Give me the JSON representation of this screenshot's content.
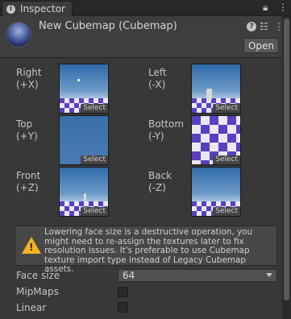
{
  "tab": {
    "title": "Inspector",
    "icon": "info-icon"
  },
  "window_controls": {
    "lock_icon": "lock-icon",
    "menu_icon": "kebab-menu-icon"
  },
  "header": {
    "title": "New Cubemap (Cubemap)",
    "help_icon": "help-icon",
    "settings_icon": "settings-sliders-icon",
    "more_icon": "kebab-menu-icon",
    "open_label": "Open"
  },
  "faces": {
    "right": {
      "name": "Right",
      "axis": "(+X)"
    },
    "left": {
      "name": "Left",
      "axis": "(-X)"
    },
    "top": {
      "name": "Top",
      "axis": "(+Y)"
    },
    "bottom": {
      "name": "Bottom",
      "axis": "(-Y)"
    },
    "front": {
      "name": "Front",
      "axis": "(+Z)"
    },
    "back": {
      "name": "Back",
      "axis": "(-Z)"
    },
    "select_label": "Select"
  },
  "help": {
    "icon": "warning-icon",
    "text": "Lowering face size is a destructive operation, you might need to re-assign the textures later to fix resolution issues. It's preferable to use Cubemap texture import type instead of Legacy Cubemap assets."
  },
  "properties": {
    "face_size_label": "Face size",
    "face_size_value": "64",
    "mipmaps_label": "MipMaps",
    "mipmaps_checked": false,
    "linear_label": "Linear",
    "linear_checked": false
  },
  "colors": {
    "warning": "#f0b324",
    "checker_purple": "#5a3fc0",
    "sky_blue": "#2f6aa8"
  }
}
